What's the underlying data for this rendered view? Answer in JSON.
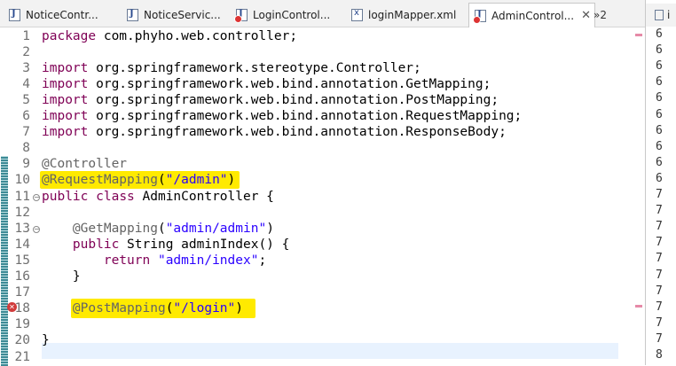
{
  "tabs": [
    {
      "label": "NoticeContr...",
      "icon": "java-file-icon"
    },
    {
      "label": "NoticeServic...",
      "icon": "java-file-icon"
    },
    {
      "label": "LoginControl...",
      "icon": "java-file-error-icon"
    },
    {
      "label": "loginMapper.xml",
      "icon": "xml-file-icon"
    },
    {
      "label": "AdminControl...",
      "icon": "java-file-error-icon",
      "active": true
    }
  ],
  "tab_close_glyph": "✕",
  "overflow": {
    "label": "»2"
  },
  "right_panel": {
    "tab_label": "i",
    "numbers": [
      "6",
      "6",
      "6",
      "6",
      "6",
      "6",
      "6",
      "6",
      "6",
      "6",
      "7",
      "7",
      "7",
      "7",
      "7",
      "7",
      "7",
      "7",
      "7",
      "7",
      "8"
    ]
  },
  "editor": {
    "lines": [
      {
        "num": "1",
        "segments": [
          {
            "t": "package",
            "c": "kw"
          },
          {
            "t": " com.phyho.web.controller;"
          }
        ]
      },
      {
        "num": "2",
        "segments": []
      },
      {
        "num": "3",
        "segments": [
          {
            "t": "import",
            "c": "kw"
          },
          {
            "t": " org.springframework.stereotype.Controller;"
          }
        ]
      },
      {
        "num": "4",
        "segments": [
          {
            "t": "import",
            "c": "kw"
          },
          {
            "t": " org.springframework.web.bind.annotation.GetMapping;"
          }
        ]
      },
      {
        "num": "5",
        "segments": [
          {
            "t": "import",
            "c": "kw"
          },
          {
            "t": " org.springframework.web.bind.annotation.PostMapping;"
          }
        ]
      },
      {
        "num": "6",
        "segments": [
          {
            "t": "import",
            "c": "kw"
          },
          {
            "t": " org.springframework.web.bind.annotation.RequestMapping;"
          }
        ]
      },
      {
        "num": "7",
        "segments": [
          {
            "t": "import",
            "c": "kw"
          },
          {
            "t": " org.springframework.web.bind.annotation.ResponseBody;"
          }
        ]
      },
      {
        "num": "8",
        "segments": []
      },
      {
        "num": "9",
        "segments": [
          {
            "t": "@Controller",
            "c": "ann"
          }
        ]
      },
      {
        "num": "10",
        "segments": [
          {
            "t": "@RequestMapping",
            "c": "ann"
          },
          {
            "t": "("
          },
          {
            "t": "\"/admin\"",
            "c": "str"
          },
          {
            "t": ")"
          }
        ],
        "highlight": "hl"
      },
      {
        "num": "11",
        "segments": [
          {
            "t": "public",
            "c": "kw"
          },
          {
            "t": " "
          },
          {
            "t": "class",
            "c": "kw"
          },
          {
            "t": " AdminController {"
          }
        ]
      },
      {
        "num": "12",
        "segments": []
      },
      {
        "num": "13",
        "segments": [
          {
            "t": "    "
          },
          {
            "t": "@GetMapping",
            "c": "ann"
          },
          {
            "t": "("
          },
          {
            "t": "\"admin/admin\"",
            "c": "str"
          },
          {
            "t": ")"
          }
        ]
      },
      {
        "num": "14",
        "segments": [
          {
            "t": "    "
          },
          {
            "t": "public",
            "c": "kw"
          },
          {
            "t": " String adminIndex() {"
          }
        ]
      },
      {
        "num": "15",
        "segments": [
          {
            "t": "        "
          },
          {
            "t": "return",
            "c": "kw"
          },
          {
            "t": " "
          },
          {
            "t": "\"admin/index\"",
            "c": "str"
          },
          {
            "t": ";"
          }
        ]
      },
      {
        "num": "16",
        "segments": [
          {
            "t": "    }"
          }
        ]
      },
      {
        "num": "17",
        "segments": []
      },
      {
        "num": "18",
        "segments": [
          {
            "t": "    "
          },
          {
            "t": "@PostMapping",
            "c": "ann"
          },
          {
            "t": "("
          },
          {
            "t": "\"/login\"",
            "c": "str"
          },
          {
            "t": ")"
          }
        ],
        "highlight": "hl2"
      },
      {
        "num": "19",
        "segments": []
      },
      {
        "num": "20",
        "segments": [
          {
            "t": "}"
          }
        ]
      },
      {
        "num": "21",
        "segments": []
      }
    ]
  },
  "colors": {
    "keyword": "#7f0055",
    "string": "#2a00ff",
    "annotation": "#646464",
    "highlight": "#ffea00",
    "current_line": "#e8f2fe",
    "error": "#d13b3b"
  }
}
